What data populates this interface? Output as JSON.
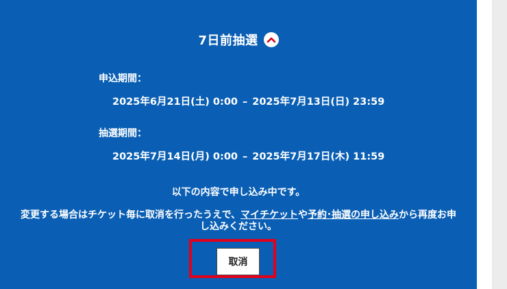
{
  "lottery": {
    "title": "7日前抽選",
    "toggle_icon": "chevron-up-icon",
    "application_period": {
      "label": "申込期間：",
      "start": "2025年6月21日(土) 0:00",
      "separator": "–",
      "end": "2025年7月13日(日) 23:59"
    },
    "drawing_period": {
      "label": "抽選期間：",
      "start": "2025年7月14日(月) 0:00",
      "separator": "–",
      "end": "2025年7月17日(木) 11:59"
    },
    "notice": "以下の内容で申し込み中です。",
    "instructions": {
      "before_link1": "変更する場合はチケット毎に取消を行ったうえで、",
      "link1": "マイチケット",
      "between_links": "や",
      "link2": "予約･抽選の申し込み",
      "after_link2": "から再度お申し込みください。"
    },
    "cancel_button_label": "取消"
  },
  "colors": {
    "panel_background": "#0a5fb4",
    "highlight_border": "#e3001b",
    "text": "#ffffff"
  }
}
